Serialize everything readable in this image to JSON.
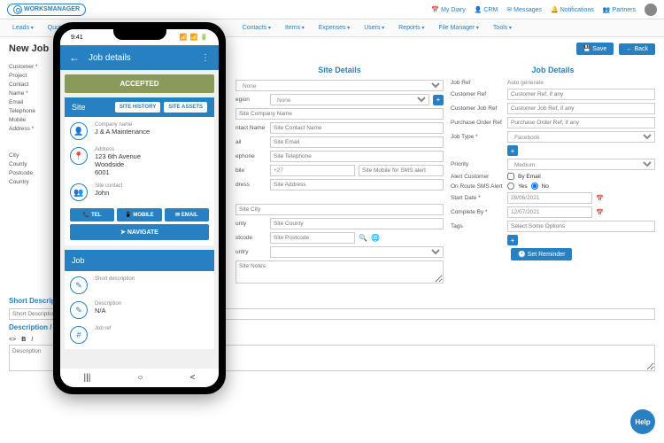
{
  "brand": "WORKSMANAGER",
  "topLinks": [
    "My Diary",
    "CRM",
    "Messages",
    "Notifications",
    "Partners"
  ],
  "nav": [
    "Leads",
    "Quot",
    "Contacts",
    "Items",
    "Expenses",
    "Users",
    "Reports",
    "File Manager",
    "Tools"
  ],
  "pageTitle": "New Job",
  "buttons": {
    "save": "Save",
    "back": "Back",
    "setReminder": "Set Reminder"
  },
  "customerCol": {
    "rows": [
      {
        "lbl": "Customer *"
      },
      {
        "lbl": "Project"
      },
      {
        "lbl": "Contact"
      },
      {
        "lbl": "Name *"
      },
      {
        "lbl": "Email"
      },
      {
        "lbl": "Telephone"
      },
      {
        "lbl": "Mobile"
      },
      {
        "lbl": "Address *"
      },
      {
        "lbl": "City"
      },
      {
        "lbl": "County"
      },
      {
        "lbl": "Postcode"
      },
      {
        "lbl": "Country"
      }
    ]
  },
  "siteDetails": {
    "title": "Site Details",
    "noneOption": "None",
    "placeholders": {
      "company": "Site Company Name",
      "contact": "Site Contact Name",
      "email": "Site Email",
      "telephone": "Site Telephone",
      "mobilePrefix": "+27",
      "mobile": "Site Mobile for SMS alert",
      "address": "Site Address",
      "city": "Site City",
      "county": "Site County",
      "postcode": "Site Postcode",
      "notes": "Site Notes"
    },
    "labels": {
      "region": "egion",
      "contact": "ntact Name",
      "email": "ail",
      "phone": "ephone",
      "mobile": "bile",
      "address": "dress",
      "city": "",
      "county": "unty",
      "postcode": "stcode",
      "country": "untry"
    }
  },
  "jobDetails": {
    "title": "Job Details",
    "labels": {
      "jobRef": "Job Ref",
      "customerRef": "Customer Ref",
      "customerJobRef": "Customer Job Ref",
      "poRef": "Purchase Order Ref",
      "jobType": "Job Type *",
      "priority": "Priority",
      "alertCustomer": "Alert Customer",
      "smsAlert": "On Route SMS Alert",
      "startDate": "Start Date *",
      "completeBy": "Complete By *",
      "tags": "Tags"
    },
    "values": {
      "autoGen": "Auto generate",
      "jobType": "Facebook",
      "priority": "Medium",
      "startDate": "28/06/2021",
      "completeBy": "12/07/2021",
      "tags": "Select Some Options"
    },
    "placeholders": {
      "customerRef": "Customer Ref, if any",
      "customerJobRef": "Customer Job Ref, if any",
      "poRef": "Purchase Order Ref, if any"
    },
    "byEmail": "By Email",
    "yes": "Yes",
    "no": "No"
  },
  "shortDesc": {
    "title": "Short Description",
    "placeholder": "Short Description"
  },
  "desc": {
    "title": "Description / Instructions",
    "placeholder": "Description"
  },
  "help": "Help",
  "phone": {
    "time": "9:41",
    "header": "Job details",
    "accepted": "ACCEPTED",
    "site": {
      "label": "Site",
      "history": "SITE HISTORY",
      "assets": "SITE ASSETS"
    },
    "company": {
      "lbl": "Company name",
      "val": "J & A Maintenance"
    },
    "address": {
      "lbl": "Address",
      "line1": "123 6th Avenue",
      "line2": "Woodside",
      "line3": "6001"
    },
    "contact": {
      "lbl": "Site contact",
      "val": "John"
    },
    "actions": {
      "tel": "TEL",
      "mobile": "MOBILE",
      "email": "EMAIL",
      "navigate": "NAVIGATE"
    },
    "job": {
      "label": "Job",
      "shortDesc": "Short description",
      "desc": "Description",
      "descVal": "N/A",
      "jobRef": "Job ref"
    }
  }
}
